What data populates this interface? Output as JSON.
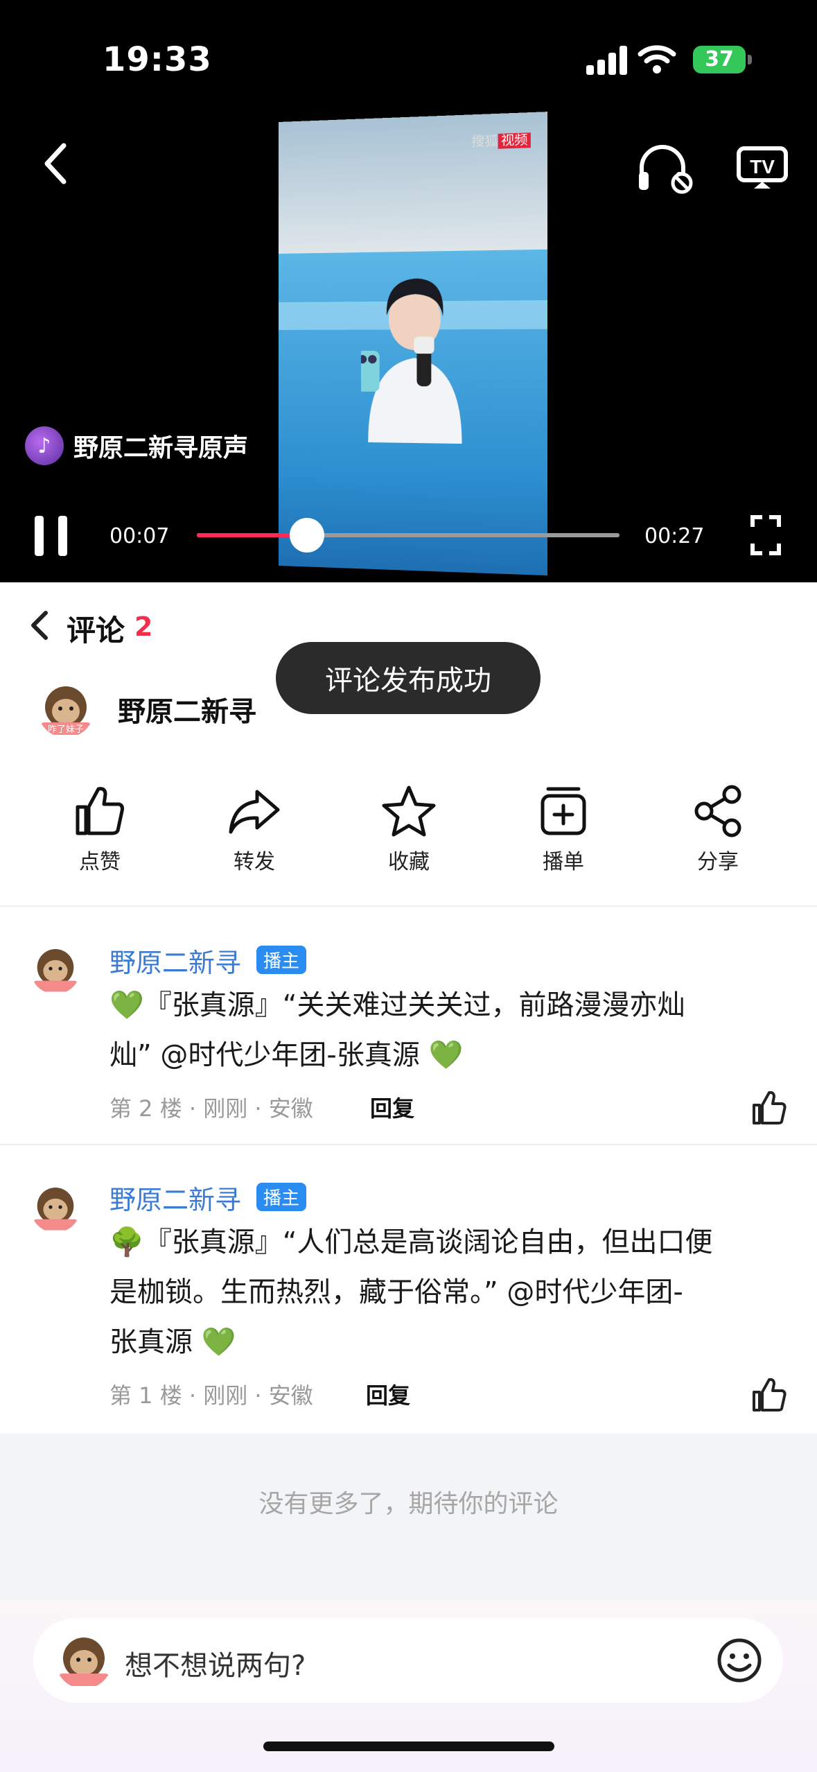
{
  "status_bar": {
    "time": "19:33",
    "battery": "37"
  },
  "video": {
    "music_label": "野原二新寻原声",
    "time_current": "00:07",
    "time_total": "00:27",
    "progress": 0.26,
    "watermark_brand": "搜狐",
    "watermark_tag": "视频"
  },
  "panel": {
    "title": "评论",
    "count": "2"
  },
  "toast": "评论发布成功",
  "author": {
    "name": "野原二新寻",
    "avatar_caption": "咋了妹子"
  },
  "actions": [
    {
      "label": "点赞",
      "icon": "thumb-up-icon"
    },
    {
      "label": "转发",
      "icon": "forward-icon"
    },
    {
      "label": "收藏",
      "icon": "star-icon"
    },
    {
      "label": "播单",
      "icon": "playlist-add-icon"
    },
    {
      "label": "分享",
      "icon": "share-icon"
    }
  ],
  "comments": [
    {
      "author": "野原二新寻",
      "badge": "播主",
      "lines": [
        "💚『张真源』“关关难过关关过，前路漫漫亦灿",
        "灿” @时代少年团-张真源 💚"
      ],
      "meta": "第 2 楼 · 刚刚 · 安徽",
      "reply": "回复"
    },
    {
      "author": "野原二新寻",
      "badge": "播主",
      "lines": [
        "🌳『张真源』“人们总是高谈阔论自由，但出口便",
        "是枷锁。生而热烈，藏于俗常。” @时代少年团-",
        "张真源 💚"
      ],
      "meta": "第 1 楼 · 刚刚 · 安徽",
      "reply": "回复"
    }
  ],
  "footer_text": "没有更多了，期待你的评论",
  "input": {
    "placeholder": "想不想说两句?"
  },
  "colors": {
    "accent": "#ff2a55",
    "link": "#3b7bd4",
    "badge": "#2a8cf0",
    "count": "#f0304e"
  }
}
